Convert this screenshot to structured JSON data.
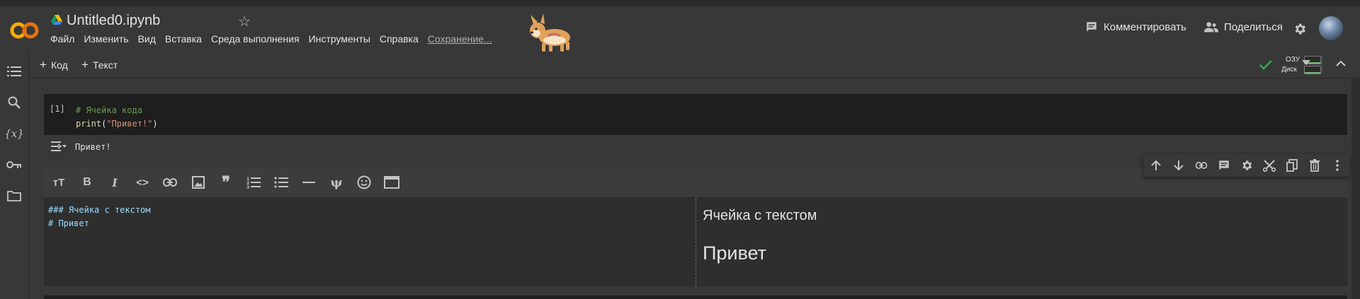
{
  "header": {
    "logo_text": "CO",
    "notebook_title": "Untitled0.ipynb",
    "menu": [
      "Файл",
      "Изменить",
      "Вид",
      "Вставка",
      "Среда выполнения",
      "Инструменты",
      "Справка"
    ],
    "saving_status": "Сохранение...",
    "comment_label": "Комментировать",
    "share_label": "Поделиться",
    "accent_color": "#f9ab00"
  },
  "toolbar": {
    "add_code": "Код",
    "add_text": "Текст",
    "ram_label": "ОЗУ",
    "disk_label": "Диск"
  },
  "code_cell": {
    "exec_count": "[1]",
    "line1": "# Ячейка кода",
    "fn": "print",
    "open": "(",
    "string": "\"Привет!\"",
    "close": ")",
    "output": "Привет!"
  },
  "text_cell": {
    "source_line1": "### Ячейка с текстом",
    "source_line2": "# Привет",
    "preview_h3": "Ячейка с текстом",
    "preview_h1": "Привет"
  },
  "icons": {
    "sidebar": [
      "toc-icon",
      "search-icon",
      "variables-icon",
      "key-icon",
      "folder-icon"
    ],
    "format_bar": [
      "text-size-icon",
      "bold-icon",
      "italic-icon",
      "code-icon",
      "link-icon",
      "image-icon",
      "quote-icon",
      "numbered-list-icon",
      "bullet-list-icon",
      "horizontal-rule-icon",
      "psi-icon",
      "emoji-icon",
      "preview-layout-icon"
    ],
    "cell_tools": [
      "move-up-icon",
      "move-down-icon",
      "link-icon",
      "comment-icon",
      "settings-icon",
      "cut-icon",
      "mirror-icon",
      "delete-icon",
      "more-icon"
    ]
  }
}
